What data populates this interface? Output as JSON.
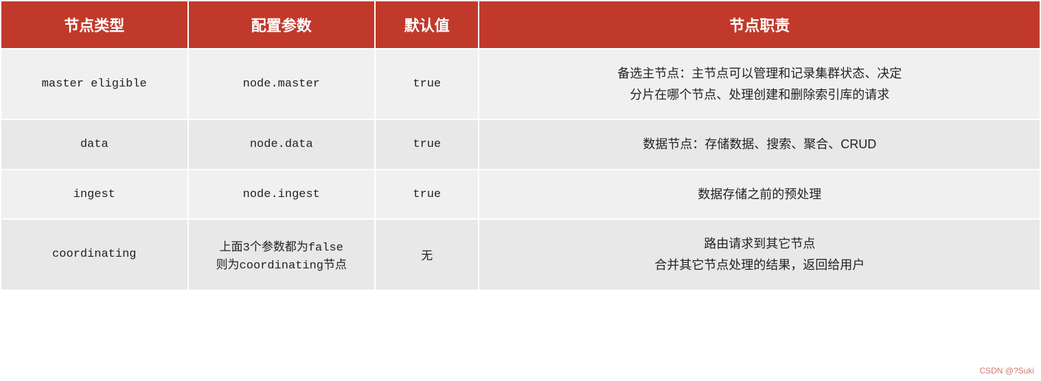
{
  "table": {
    "headers": {
      "type": "节点类型",
      "param": "配置参数",
      "default": "默认值",
      "desc": "节点职责"
    },
    "rows": [
      {
        "type": "master eligible",
        "param": "node.master",
        "default": "true",
        "desc": "备选主节点：主节点可以管理和记录集群状态、决定\n分片在哪个节点、处理创建和删除索引库的请求"
      },
      {
        "type": "data",
        "param": "node.data",
        "default": "true",
        "desc": "数据节点：存储数据、搜索、聚合、CRUD"
      },
      {
        "type": "ingest",
        "param": "node.ingest",
        "default": "true",
        "desc": "数据存储之前的预处理"
      },
      {
        "type": "coordinating",
        "param": "上面3个参数都为false\n则为coordinating节点",
        "default": "无",
        "desc": "路由请求到其它节点\n合并其它节点处理的结果，返回给用户"
      }
    ]
  },
  "watermark": "CSDN @?Suki"
}
